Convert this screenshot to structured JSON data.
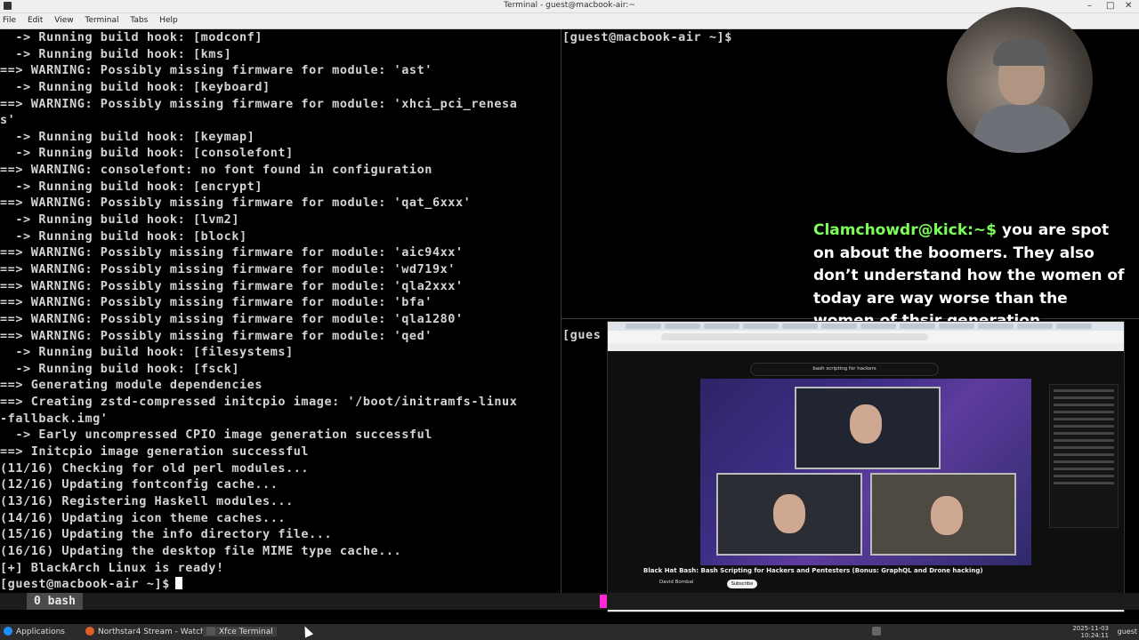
{
  "window": {
    "title": "Terminal - guest@macbook-air:~",
    "min_glyph": "–",
    "max_glyph": "□",
    "close_glyph": "✕"
  },
  "menu": [
    "File",
    "Edit",
    "View",
    "Terminal",
    "Tabs",
    "Help"
  ],
  "left_pane": {
    "lines": [
      "  -> Running build hook: [modconf]",
      "  -> Running build hook: [kms]",
      "==> WARNING: Possibly missing firmware for module: 'ast'",
      "  -> Running build hook: [keyboard]",
      "==> WARNING: Possibly missing firmware for module: 'xhci_pci_renesa",
      "s'",
      "  -> Running build hook: [keymap]",
      "  -> Running build hook: [consolefont]",
      "==> WARNING: consolefont: no font found in configuration",
      "  -> Running build hook: [encrypt]",
      "==> WARNING: Possibly missing firmware for module: 'qat_6xxx'",
      "  -> Running build hook: [lvm2]",
      "  -> Running build hook: [block]",
      "==> WARNING: Possibly missing firmware for module: 'aic94xx'",
      "==> WARNING: Possibly missing firmware for module: 'wd719x'",
      "==> WARNING: Possibly missing firmware for module: 'qla2xxx'",
      "==> WARNING: Possibly missing firmware for module: 'bfa'",
      "==> WARNING: Possibly missing firmware for module: 'qla1280'",
      "==> WARNING: Possibly missing firmware for module: 'qed'",
      "  -> Running build hook: [filesystems]",
      "  -> Running build hook: [fsck]",
      "==> Generating module dependencies",
      "==> Creating zstd-compressed initcpio image: '/boot/initramfs-linux",
      "-fallback.img'",
      "  -> Early uncompressed CPIO image generation successful",
      "==> Initcpio image generation successful",
      "(11/16) Checking for old perl modules...",
      "(12/16) Updating fontconfig cache...",
      "(13/16) Registering Haskell modules...",
      "(14/16) Updating icon theme caches...",
      "(15/16) Updating the info directory file...",
      "(16/16) Updating the desktop file MIME type cache...",
      "[+] BlackArch Linux is ready!"
    ],
    "prompt": "[guest@macbook-air ~]$"
  },
  "top_right_pane": {
    "prompt": "[guest@macbook-air ~]$"
  },
  "bottom_right_pane": {
    "prompt": "[gues"
  },
  "chat": {
    "user": "Clamchowdr@kick:~$",
    "message": " you are spot on about the boomers. They also don’t understand how the women of today are way worse than the women of thsir generation"
  },
  "browser": {
    "search_text": "bash scripting for hackers",
    "video_title": "Black Hat Bash: Bash Scripting for Hackers and Pentesters (Bonus: GraphQL and Drone hacking)",
    "channel": "David Bombal",
    "subscribe_label": "Subscribe"
  },
  "tmux": {
    "window_label": "0 bash"
  },
  "taskbar": {
    "apps_label": "Applications",
    "browser_task": "Northstar4 Stream - Watch...",
    "terminal_task": "Xfce Terminal",
    "date": "2025-11-03",
    "time": "10:24:11",
    "user": "guest"
  },
  "colors": {
    "terminal_bg": "#000000",
    "terminal_fg": "#d3d3d3",
    "chat_user": "#7dff5a",
    "tmux_marker": "#ff2ad4"
  }
}
